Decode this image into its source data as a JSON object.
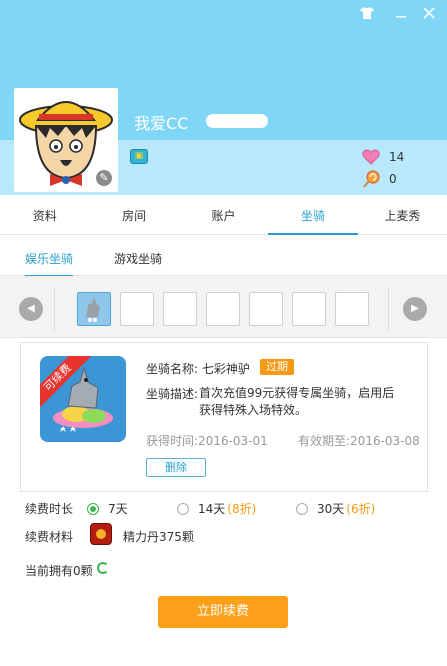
{
  "window": {
    "skin_icon": "shirt-icon",
    "min_icon": "minimize-icon",
    "close_icon": "close-icon"
  },
  "profile": {
    "username": "我爱CC",
    "hearts": "14",
    "lollipops": "0"
  },
  "tabs": [
    {
      "label": "资料"
    },
    {
      "label": "房间"
    },
    {
      "label": "账户"
    },
    {
      "label": "坐骑"
    },
    {
      "label": "上麦秀"
    }
  ],
  "subtabs": [
    {
      "label": "娱乐坐骑"
    },
    {
      "label": "游戏坐骑"
    }
  ],
  "mount": {
    "ribbon": "可续费",
    "name_label": "坐骑名称:",
    "name": "七彩神驴",
    "status": "过期",
    "desc_label": "坐骑描述:",
    "desc": "首次充值99元获得专属坐骑，启用后获得特殊入场特效。",
    "obtained": "获得时间:2016-03-01",
    "expires": "有效期至:2016-03-08",
    "delete_label": "删除"
  },
  "renew": {
    "duration_label": "续费时长",
    "options": [
      {
        "label": "7天",
        "discount": ""
      },
      {
        "label": "14天",
        "discount": "(8折)"
      },
      {
        "label": "30天",
        "discount": "(6折)"
      }
    ],
    "material_label": "续费材料",
    "material": "精力丹375颗",
    "owned": "当前拥有0颗",
    "button": "立即续费"
  },
  "colors": {
    "accent": "#2a9fd0",
    "header": "#7fd6f7",
    "button": "#fba018",
    "expired": "#f59a12"
  }
}
